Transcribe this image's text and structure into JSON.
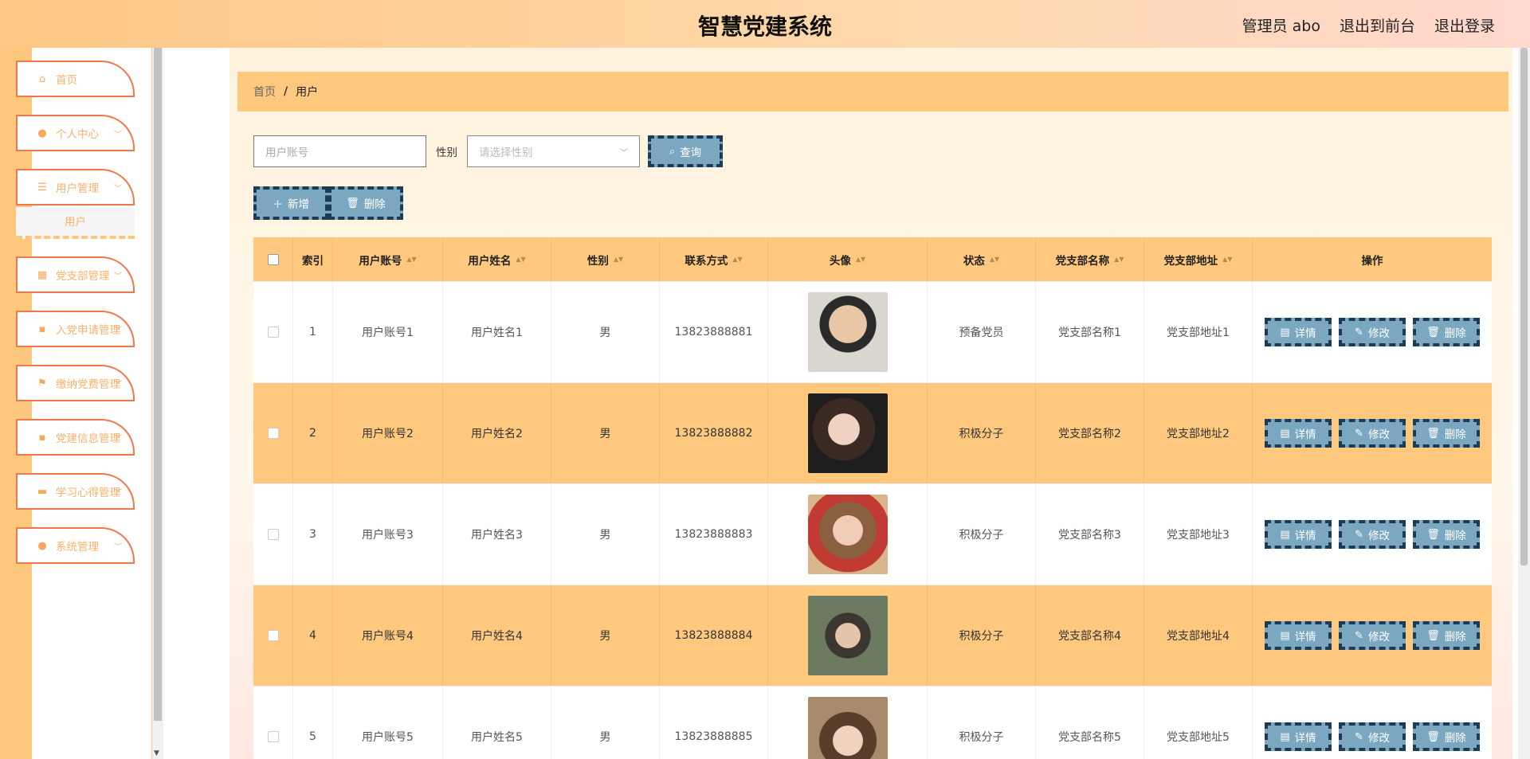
{
  "header": {
    "title": "智慧党建系统",
    "user": "管理员 abo",
    "front": "退出到前台",
    "logout": "退出登录"
  },
  "menu": [
    {
      "label": "首页",
      "icon": "home-icon"
    },
    {
      "label": "个人中心",
      "icon": "user-icon"
    },
    {
      "label": "用户管理",
      "icon": "list-icon"
    },
    {
      "label": "党支部管理",
      "icon": "grid-icon"
    },
    {
      "label": "入党申请管理",
      "icon": "apps-icon"
    },
    {
      "label": "缴纳党费管理",
      "icon": "flag-icon"
    },
    {
      "label": "党建信息管理",
      "icon": "apps-icon"
    },
    {
      "label": "学习心得管理",
      "icon": "chat-icon"
    },
    {
      "label": "系统管理",
      "icon": "pin-icon"
    }
  ],
  "submenu": {
    "label": "用户"
  },
  "breadcrumb": {
    "home": "首页",
    "sep": "/",
    "current": "用户"
  },
  "search": {
    "account_placeholder": "用户账号",
    "sex_label": "性别",
    "sex_placeholder": "请选择性别",
    "query": "查询"
  },
  "actions": {
    "add": "新增",
    "delete": "删除"
  },
  "table": {
    "headers": [
      "索引",
      "用户账号",
      "用户姓名",
      "性别",
      "联系方式",
      "头像",
      "状态",
      "党支部名称",
      "党支部地址",
      "操作"
    ],
    "rows": [
      {
        "idx": "1",
        "account": "用户账号1",
        "name": "用户姓名1",
        "sex": "男",
        "tel": "13823888881",
        "status": "预备党员",
        "branch": "党支部名称1",
        "addr": "党支部地址1"
      },
      {
        "idx": "2",
        "account": "用户账号2",
        "name": "用户姓名2",
        "sex": "男",
        "tel": "13823888882",
        "status": "积极分子",
        "branch": "党支部名称2",
        "addr": "党支部地址2"
      },
      {
        "idx": "3",
        "account": "用户账号3",
        "name": "用户姓名3",
        "sex": "男",
        "tel": "13823888883",
        "status": "积极分子",
        "branch": "党支部名称3",
        "addr": "党支部地址3"
      },
      {
        "idx": "4",
        "account": "用户账号4",
        "name": "用户姓名4",
        "sex": "男",
        "tel": "13823888884",
        "status": "积极分子",
        "branch": "党支部名称4",
        "addr": "党支部地址4"
      },
      {
        "idx": "5",
        "account": "用户账号5",
        "name": "用户姓名5",
        "sex": "男",
        "tel": "13823888885",
        "status": "积极分子",
        "branch": "党支部名称5",
        "addr": "党支部地址5"
      }
    ],
    "ops": {
      "detail": "详情",
      "edit": "修改",
      "delete": "删除"
    }
  }
}
